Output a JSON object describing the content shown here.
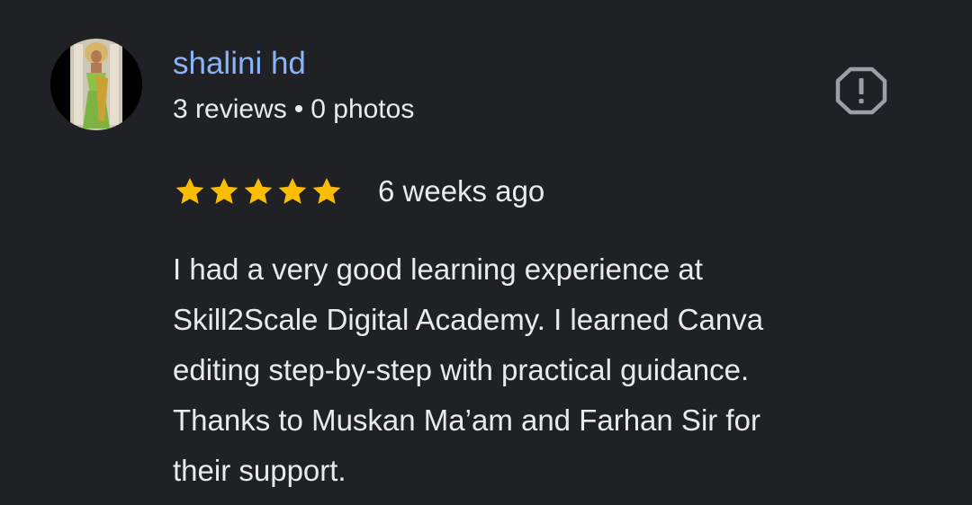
{
  "reviewer": {
    "name": "shalini hd",
    "reviews_count": "3 reviews",
    "separator": "•",
    "photos_count": "0 photos",
    "avatar_icon": "profile-photo"
  },
  "report": {
    "icon": "report-flag-icon"
  },
  "rating": {
    "stars": 5,
    "max_stars": 5,
    "star_color": "#fbbc04",
    "date": "6 weeks ago"
  },
  "review": {
    "lines": [
      "I had a very good learning experience at",
      "Skill2Scale Digital Academy. I learned Canva",
      "editing step-by-step with practical guidance.",
      "Thanks to Muskan Ma’am and Farhan Sir for",
      "their support."
    ]
  },
  "colors": {
    "background": "#202124",
    "name": "#8ab4f8",
    "text": "#e8eaed",
    "icon": "#9aa0a6"
  }
}
